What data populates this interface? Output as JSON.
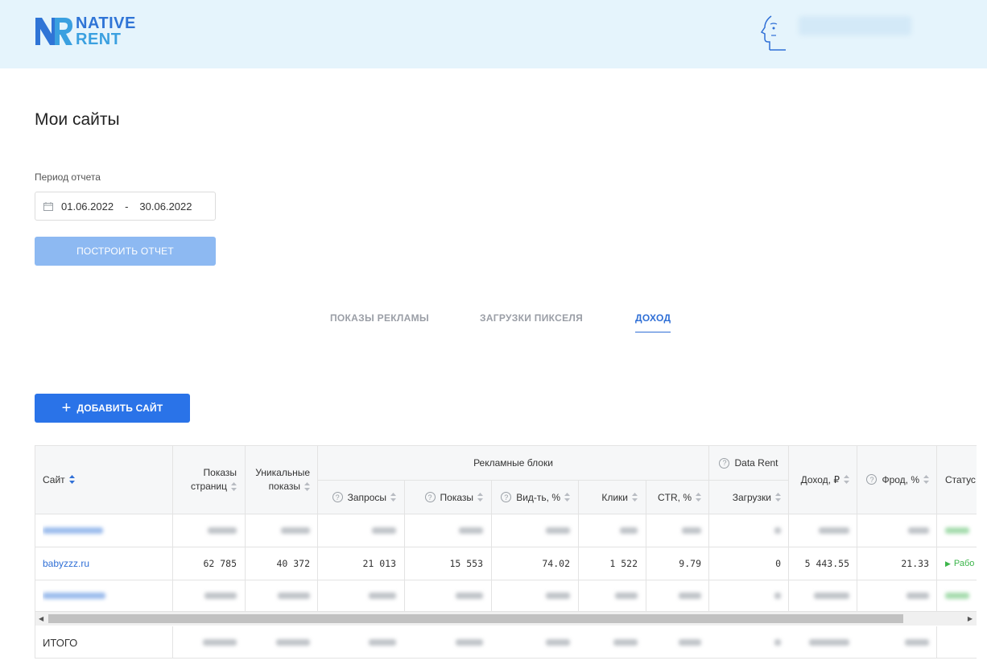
{
  "brand": {
    "line1": "NATIVE",
    "line2": "RENT"
  },
  "page": {
    "title": "Мои сайты"
  },
  "report": {
    "period_label": "Период отчета",
    "date_from": "01.06.2022",
    "date_sep": "-",
    "date_to": "30.06.2022",
    "build_label": "ПОСТРОИТЬ ОТЧЕТ"
  },
  "tabs": [
    {
      "label": "ПОКАЗЫ РЕКЛАМЫ",
      "active": false
    },
    {
      "label": "ЗАГРУЗКИ ПИКСЕЛЯ",
      "active": false
    },
    {
      "label": "ДОХОД",
      "active": true
    }
  ],
  "add_site_label": "ДОБАВИТЬ САЙТ",
  "table": {
    "headers": {
      "site": "Сайт",
      "page_views_1": "Показы",
      "page_views_2": "страниц",
      "unique_1": "Уникальные",
      "unique_2": "показы",
      "ad_blocks": "Рекламные блоки",
      "requests": "Запросы",
      "impressions": "Показы",
      "viewability": "Вид-ть, %",
      "clicks": "Клики",
      "ctr": "CTR, %",
      "data_rent": "Data Rent",
      "loads": "Загрузки",
      "income": "Доход, ₽",
      "fraud": "Фрод, %",
      "status": "Статус"
    },
    "row": {
      "site": "babyzzz.ru",
      "page_views": "62 785",
      "unique": "40 372",
      "requests": "21 013",
      "impressions": "15 553",
      "viewability": "74.02",
      "clicks": "1 522",
      "ctr": "9.79",
      "loads": "0",
      "income": "5 443.55",
      "fraud": "21.33",
      "status": "Рабо"
    },
    "total_label": "ИТОГО"
  },
  "colors": {
    "header_bg": "#e5f4fc",
    "brand_blue": "#2f74d6",
    "primary_button": "#2a73e8",
    "disabled_button": "#8db9f2",
    "status_green": "#3bb54a"
  }
}
